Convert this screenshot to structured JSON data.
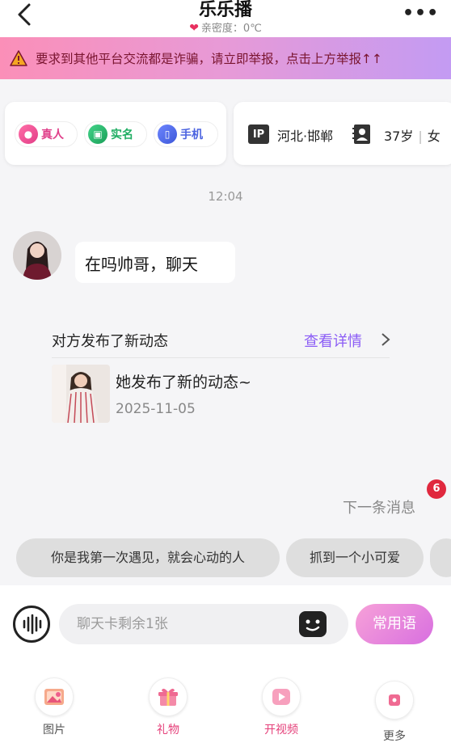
{
  "header": {
    "title": "乐乐播",
    "intimacy": "亲密度：0℃"
  },
  "warning": {
    "text": "要求到其他平台交流都是诈骗，请立即举报，点击上方举报↑↑"
  },
  "badges": {
    "real_person": "真人",
    "real_name": "实名",
    "phone": "手机"
  },
  "profile": {
    "ip_label": "IP",
    "ip_location": "河北·邯郸",
    "age": "37岁",
    "gender": "女"
  },
  "chat": {
    "time": "12:04",
    "message": "在吗帅哥，聊天",
    "dynamic": {
      "title": "对方发布了新动态",
      "link": "查看详情",
      "text": "她发布了新的动态~",
      "date": "2025-11-05"
    },
    "next_message": "下一条消息",
    "unread_count": "6"
  },
  "quick_phrases": [
    "你是我第一次遇见，就会心动的人",
    "抓到一个小可爱"
  ],
  "input": {
    "placeholder": "聊天卡剩余1张",
    "common_phrases_label": "常用语"
  },
  "toolbar": {
    "image": "图片",
    "gift": "礼物",
    "video": "开视频",
    "more": "更多"
  },
  "colors": {
    "accent_pink": "#e5407a",
    "link_purple": "#8b5cf6",
    "badge_red": "#e0283e"
  }
}
